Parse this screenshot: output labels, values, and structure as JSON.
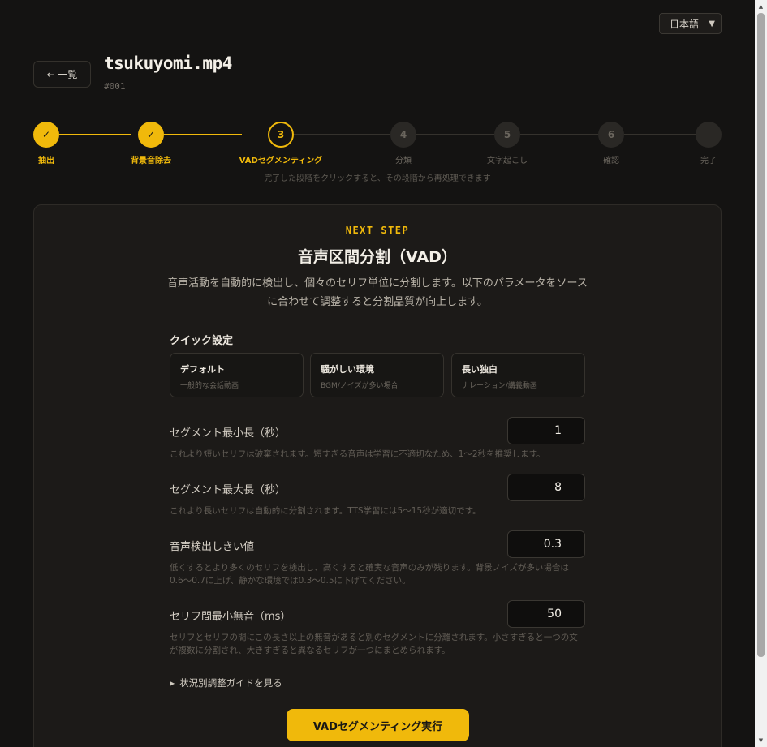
{
  "language": {
    "selected": "日本語",
    "chevron_icon": "chevron-down-icon"
  },
  "header": {
    "back_label": "← 一覧",
    "title": "tsukuyomi.mp4",
    "id": "#001"
  },
  "stepper": {
    "hint": "完了した段階をクリックすると、その段階から再処理できます",
    "steps": [
      {
        "marker": "✓",
        "label": "抽出",
        "state": "done"
      },
      {
        "marker": "✓",
        "label": "背景音除去",
        "state": "done"
      },
      {
        "marker": "3",
        "label": "VADセグメンティング",
        "state": "active"
      },
      {
        "marker": "4",
        "label": "分類",
        "state": "todo"
      },
      {
        "marker": "5",
        "label": "文字起こし",
        "state": "todo"
      },
      {
        "marker": "6",
        "label": "確認",
        "state": "todo"
      },
      {
        "marker": "",
        "label": "完了",
        "state": "todo"
      }
    ]
  },
  "card": {
    "eyebrow": "NEXT STEP",
    "title": "音声区間分割（VAD）",
    "description": "音声活動を自動的に検出し、個々のセリフ単位に分割します。以下のパラメータをソースに合わせて調整すると分割品質が向上します。",
    "quick_title": "クイック設定",
    "presets": [
      {
        "name": "デフォルト",
        "desc": "一般的な会話動画"
      },
      {
        "name": "騒がしい環境",
        "desc": "BGM/ノイズが多い場合"
      },
      {
        "name": "長い独白",
        "desc": "ナレーション/講義動画"
      }
    ],
    "params": [
      {
        "label": "セグメント最小長（秒）",
        "value": "1",
        "help": "これより短いセリフは破棄されます。短すぎる音声は学習に不適切なため、1〜2秒を推奨します。"
      },
      {
        "label": "セグメント最大長（秒）",
        "value": "8",
        "help": "これより長いセリフは自動的に分割されます。TTS学習には5〜15秒が適切です。"
      },
      {
        "label": "音声検出しきい値",
        "value": "0.3",
        "help": "低くするとより多くのセリフを検出し、高くすると確実な音声のみが残ります。背景ノイズが多い場合は0.6〜0.7に上げ、静かな環境では0.3〜0.5に下げてください。"
      },
      {
        "label": "セリフ間最小無音（ms）",
        "value": "50",
        "help": "セリフとセリフの間にこの長さ以上の無音があると別のセグメントに分離されます。小さすぎると一つの文が複数に分割され、大きすぎると異なるセリフが一つにまとめられます。"
      }
    ],
    "guide_label": "状況別調整ガイドを見る",
    "run_label": "VADセグメンティング実行"
  },
  "colors": {
    "accent": "#f0b90b",
    "background": "#141312",
    "card": "#1c1a18"
  }
}
